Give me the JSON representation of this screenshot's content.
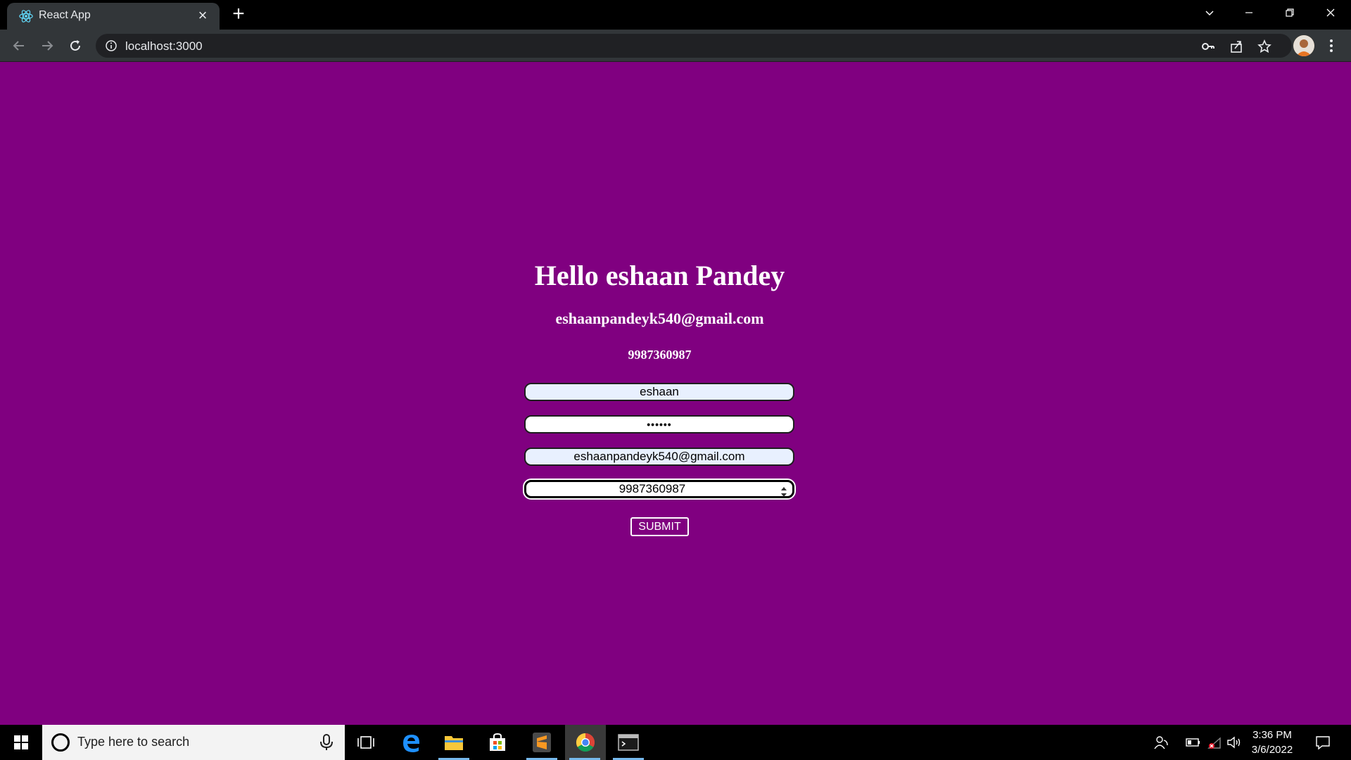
{
  "browser": {
    "tab_title": "React App",
    "url": "localhost:3000"
  },
  "page": {
    "heading": "Hello eshaan Pandey",
    "email": "eshaanpandeyk540@gmail.com",
    "phone": "9987360987",
    "bg_color": "#800080"
  },
  "form": {
    "name_value": "eshaan",
    "password_value": "••••••",
    "email_value": "eshaanpandeyk540@gmail.com",
    "phone_value": "9987360987",
    "submit_label": "SUBMIT"
  },
  "taskbar": {
    "search_placeholder": "Type here to search",
    "time": "3:36 PM",
    "date": "3/6/2022",
    "apps": [
      "task-view-icon",
      "edge-icon",
      "file-explorer-icon",
      "store-icon",
      "sublime-text-icon",
      "chrome-icon",
      "terminal-icon"
    ]
  }
}
